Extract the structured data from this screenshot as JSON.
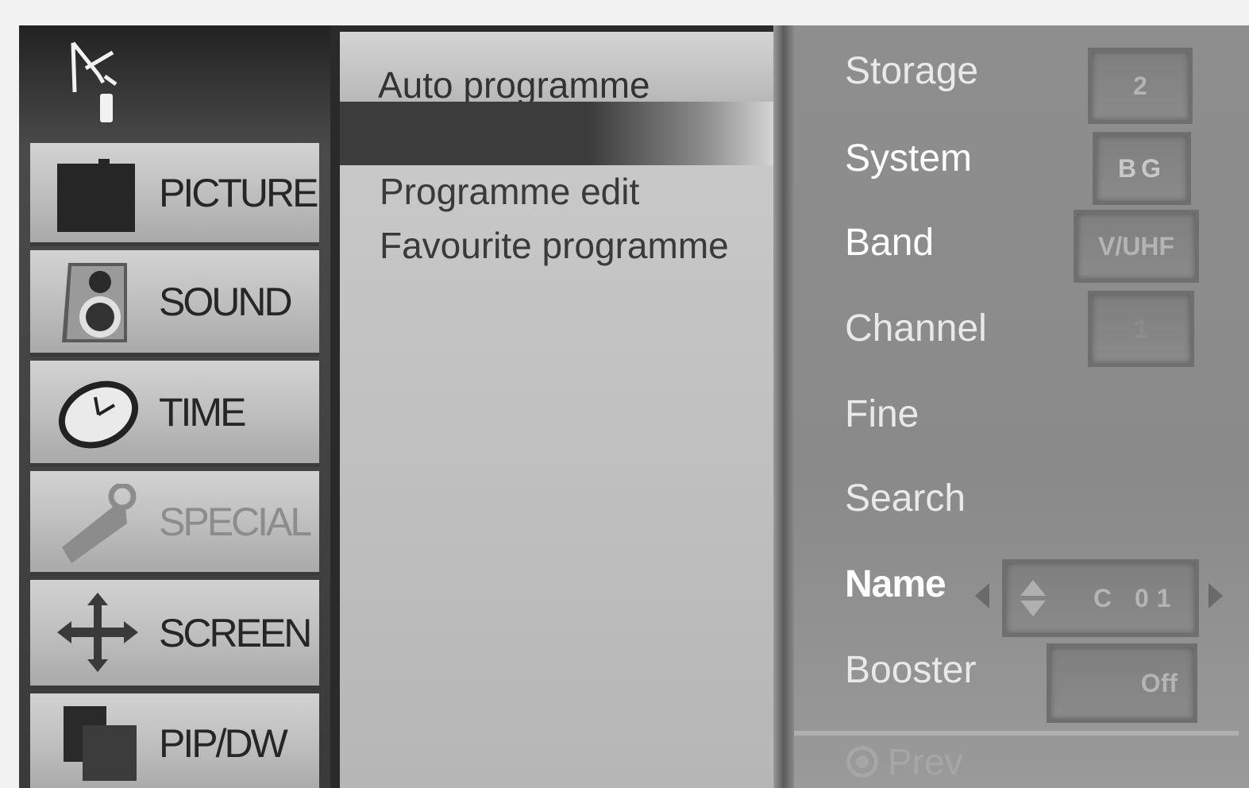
{
  "categories": [
    {
      "label": "PICTURE",
      "icon": "picture-icon",
      "dimmed": false
    },
    {
      "label": "SOUND",
      "icon": "speaker-icon",
      "dimmed": false
    },
    {
      "label": "TIME",
      "icon": "clock-icon",
      "dimmed": false
    },
    {
      "label": "SPECIAL",
      "icon": "key-icon",
      "dimmed": true
    },
    {
      "label": "SCREEN",
      "icon": "move-arrows-icon",
      "dimmed": false
    },
    {
      "label": "PIP/DW",
      "icon": "pip-icon",
      "dimmed": false
    }
  ],
  "submenu": {
    "selected": "Auto programme",
    "items": [
      "Programme edit",
      "Favourite programme"
    ]
  },
  "settings": {
    "storage": {
      "label": "Storage",
      "value": "2"
    },
    "system": {
      "label": "System",
      "value": "BG"
    },
    "band": {
      "label": "Band",
      "value": "V/UHF"
    },
    "channel": {
      "label": "Channel",
      "value": "1"
    },
    "fine": {
      "label": "Fine"
    },
    "search": {
      "label": "Search"
    },
    "name": {
      "label": "Name",
      "value": "C 01"
    },
    "booster": {
      "label": "Booster",
      "value": "Off"
    }
  },
  "footer": {
    "prev_label": "Prev"
  }
}
